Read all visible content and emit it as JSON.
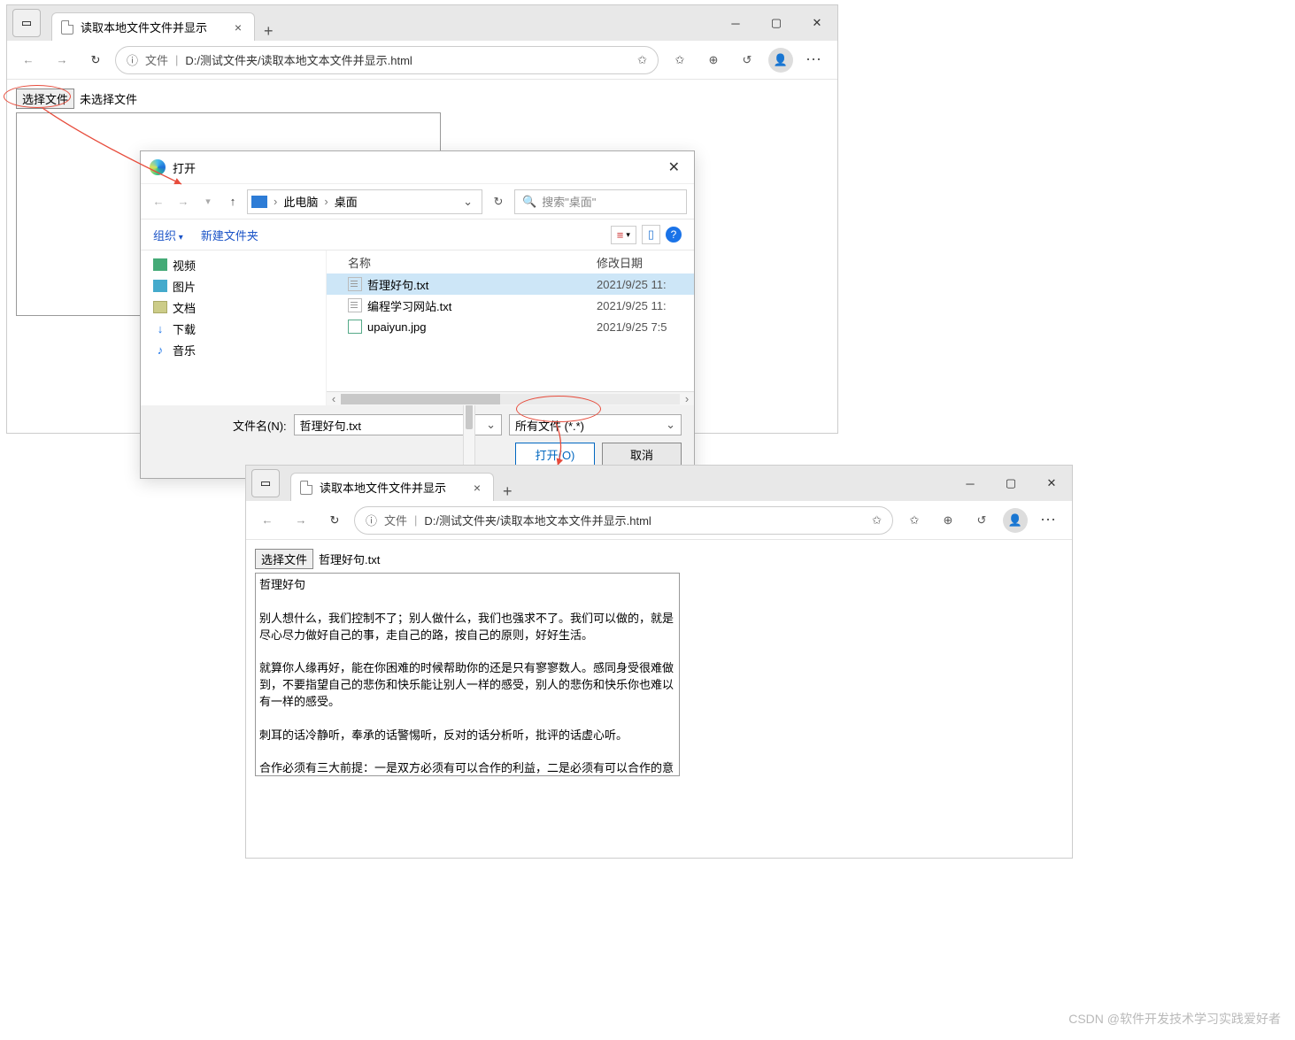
{
  "browser1": {
    "tab_title": "读取本地文件文件并显示",
    "url_label": "文件",
    "url_path": "D:/测试文件夹/读取本地文本文件并显示.html",
    "choose_button": "选择文件",
    "no_file": "未选择文件"
  },
  "dialog": {
    "title": "打开",
    "breadcrumb": {
      "root": "此电脑",
      "folder": "桌面"
    },
    "search_placeholder": "搜索\"桌面\"",
    "toolbar": {
      "organize": "组织",
      "new_folder": "新建文件夹"
    },
    "tree": [
      {
        "label": "视频",
        "icon": "video"
      },
      {
        "label": "图片",
        "icon": "image"
      },
      {
        "label": "文档",
        "icon": "doc"
      },
      {
        "label": "下载",
        "icon": "download"
      },
      {
        "label": "音乐",
        "icon": "music"
      }
    ],
    "columns": {
      "name": "名称",
      "modified": "修改日期"
    },
    "files": [
      {
        "name": "哲理好句.txt",
        "date": "2021/9/25 11:",
        "type": "txt",
        "selected": true
      },
      {
        "name": "编程学习网站.txt",
        "date": "2021/9/25 11:",
        "type": "txt",
        "selected": false
      },
      {
        "name": "upaiyun.jpg",
        "date": "2021/9/25 7:5",
        "type": "img",
        "selected": false
      }
    ],
    "filename_label": "文件名(N):",
    "filename_value": "哲理好句.txt",
    "filter_value": "所有文件 (*.*)",
    "open_button": "打开(O)",
    "cancel_button": "取消"
  },
  "browser2": {
    "tab_title": "读取本地文件文件并显示",
    "url_label": "文件",
    "url_path": "D:/测试文件夹/读取本地文本文件并显示.html",
    "choose_button": "选择文件",
    "file_chosen": "哲理好句.txt",
    "textarea_content": "哲理好句\n\n别人想什么，我们控制不了；别人做什么，我们也强求不了。我们可以做的，就是尽心尽力做好自己的事，走自己的路，按自己的原则，好好生活。\n\n就算你人缘再好，能在你困难的时候帮助你的还是只有寥寥数人。感同身受很难做到，不要指望自己的悲伤和快乐能让别人一样的感受，别人的悲伤和快乐你也难以有一样的感受。\n\n刺耳的话冷静听，奉承的话警惕听，反对的话分析听，批评的话虚心听。\n\n合作必须有三大前提：一是双方必须有可以合作的利益，二是必须有可以合作的意愿，三是双方必须有共享共荣的打算。此三者缺一不"
  },
  "watermark": "CSDN @软件开发技术学习实践爱好者"
}
